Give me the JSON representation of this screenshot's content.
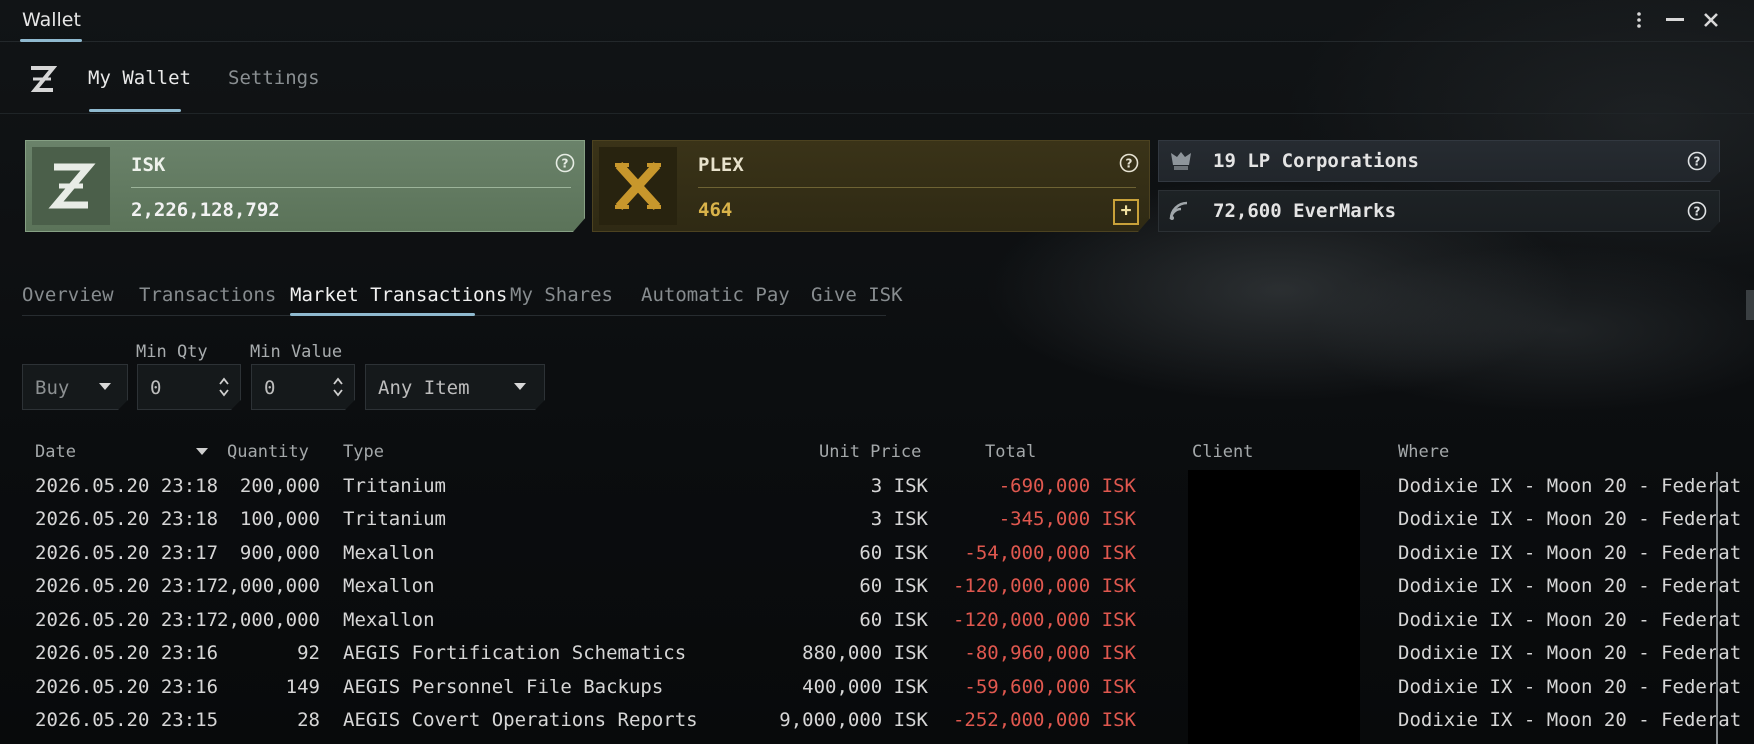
{
  "window": {
    "title": "Wallet"
  },
  "top_tabs": [
    {
      "label": "My Wallet",
      "active": true
    },
    {
      "label": "Settings",
      "active": false
    }
  ],
  "cards": {
    "isk": {
      "name": "ISK",
      "value": "2,226,128,792"
    },
    "plex": {
      "name": "PLEX",
      "value": "464"
    }
  },
  "lp": {
    "corporations": "19 LP Corporations",
    "evermarks": "72,600 EverMarks"
  },
  "sub_tabs": [
    {
      "label": "Overview",
      "active": false
    },
    {
      "label": "Transactions",
      "active": false
    },
    {
      "label": "Market Transactions",
      "active": true
    },
    {
      "label": "My Shares",
      "active": false
    },
    {
      "label": "Automatic Pay",
      "active": false
    },
    {
      "label": "Give ISK",
      "active": false
    }
  ],
  "filters": {
    "type_select": "Buy",
    "min_qty_label": "Min Qty",
    "min_qty_value": "0",
    "min_value_label": "Min Value",
    "min_value_value": "0",
    "item_select": "Any Item"
  },
  "table": {
    "headers": {
      "date": "Date",
      "quantity": "Quantity",
      "type": "Type",
      "unit_price": "Unit Price",
      "total": "Total",
      "client": "Client",
      "where": "Where"
    },
    "rows": [
      {
        "date": "2026.05.20 23:18",
        "quantity": "200,000",
        "type": "Tritanium",
        "unit_price": "3 ISK",
        "total": "-690,000 ISK",
        "where": "Dodixie IX - Moon 20 - Federat"
      },
      {
        "date": "2026.05.20 23:18",
        "quantity": "100,000",
        "type": "Tritanium",
        "unit_price": "3 ISK",
        "total": "-345,000 ISK",
        "where": "Dodixie IX - Moon 20 - Federat"
      },
      {
        "date": "2026.05.20 23:17",
        "quantity": "900,000",
        "type": "Mexallon",
        "unit_price": "60 ISK",
        "total": "-54,000,000 ISK",
        "where": "Dodixie IX - Moon 20 - Federat"
      },
      {
        "date": "2026.05.20 23:17",
        "quantity": "2,000,000",
        "type": "Mexallon",
        "unit_price": "60 ISK",
        "total": "-120,000,000 ISK",
        "where": "Dodixie IX - Moon 20 - Federat"
      },
      {
        "date": "2026.05.20 23:17",
        "quantity": "2,000,000",
        "type": "Mexallon",
        "unit_price": "60 ISK",
        "total": "-120,000,000 ISK",
        "where": "Dodixie IX - Moon 20 - Federat"
      },
      {
        "date": "2026.05.20 23:16",
        "quantity": "92",
        "type": "AEGIS Fortification Schematics",
        "unit_price": "880,000 ISK",
        "total": "-80,960,000 ISK",
        "where": "Dodixie IX - Moon 20 - Federat"
      },
      {
        "date": "2026.05.20 23:16",
        "quantity": "149",
        "type": "AEGIS Personnel File Backups",
        "unit_price": "400,000 ISK",
        "total": "-59,600,000 ISK",
        "where": "Dodixie IX - Moon 20 - Federat"
      },
      {
        "date": "2026.05.20 23:15",
        "quantity": "28",
        "type": "AEGIS Covert Operations Reports",
        "unit_price": "9,000,000 ISK",
        "total": "-252,000,000 ISK",
        "where": "Dodixie IX - Moon 20 - Federat"
      }
    ]
  },
  "colors": {
    "accent": "#8fb9cf",
    "isk_card": "#6a826a",
    "plex_gold": "#d9b34a",
    "negative_total": "#e0584f"
  },
  "icons": {
    "isk": "isk-z-icon",
    "plex": "plex-x-icon",
    "lp": "lp-corporation-icon",
    "evermarks": "evermarks-icon"
  }
}
